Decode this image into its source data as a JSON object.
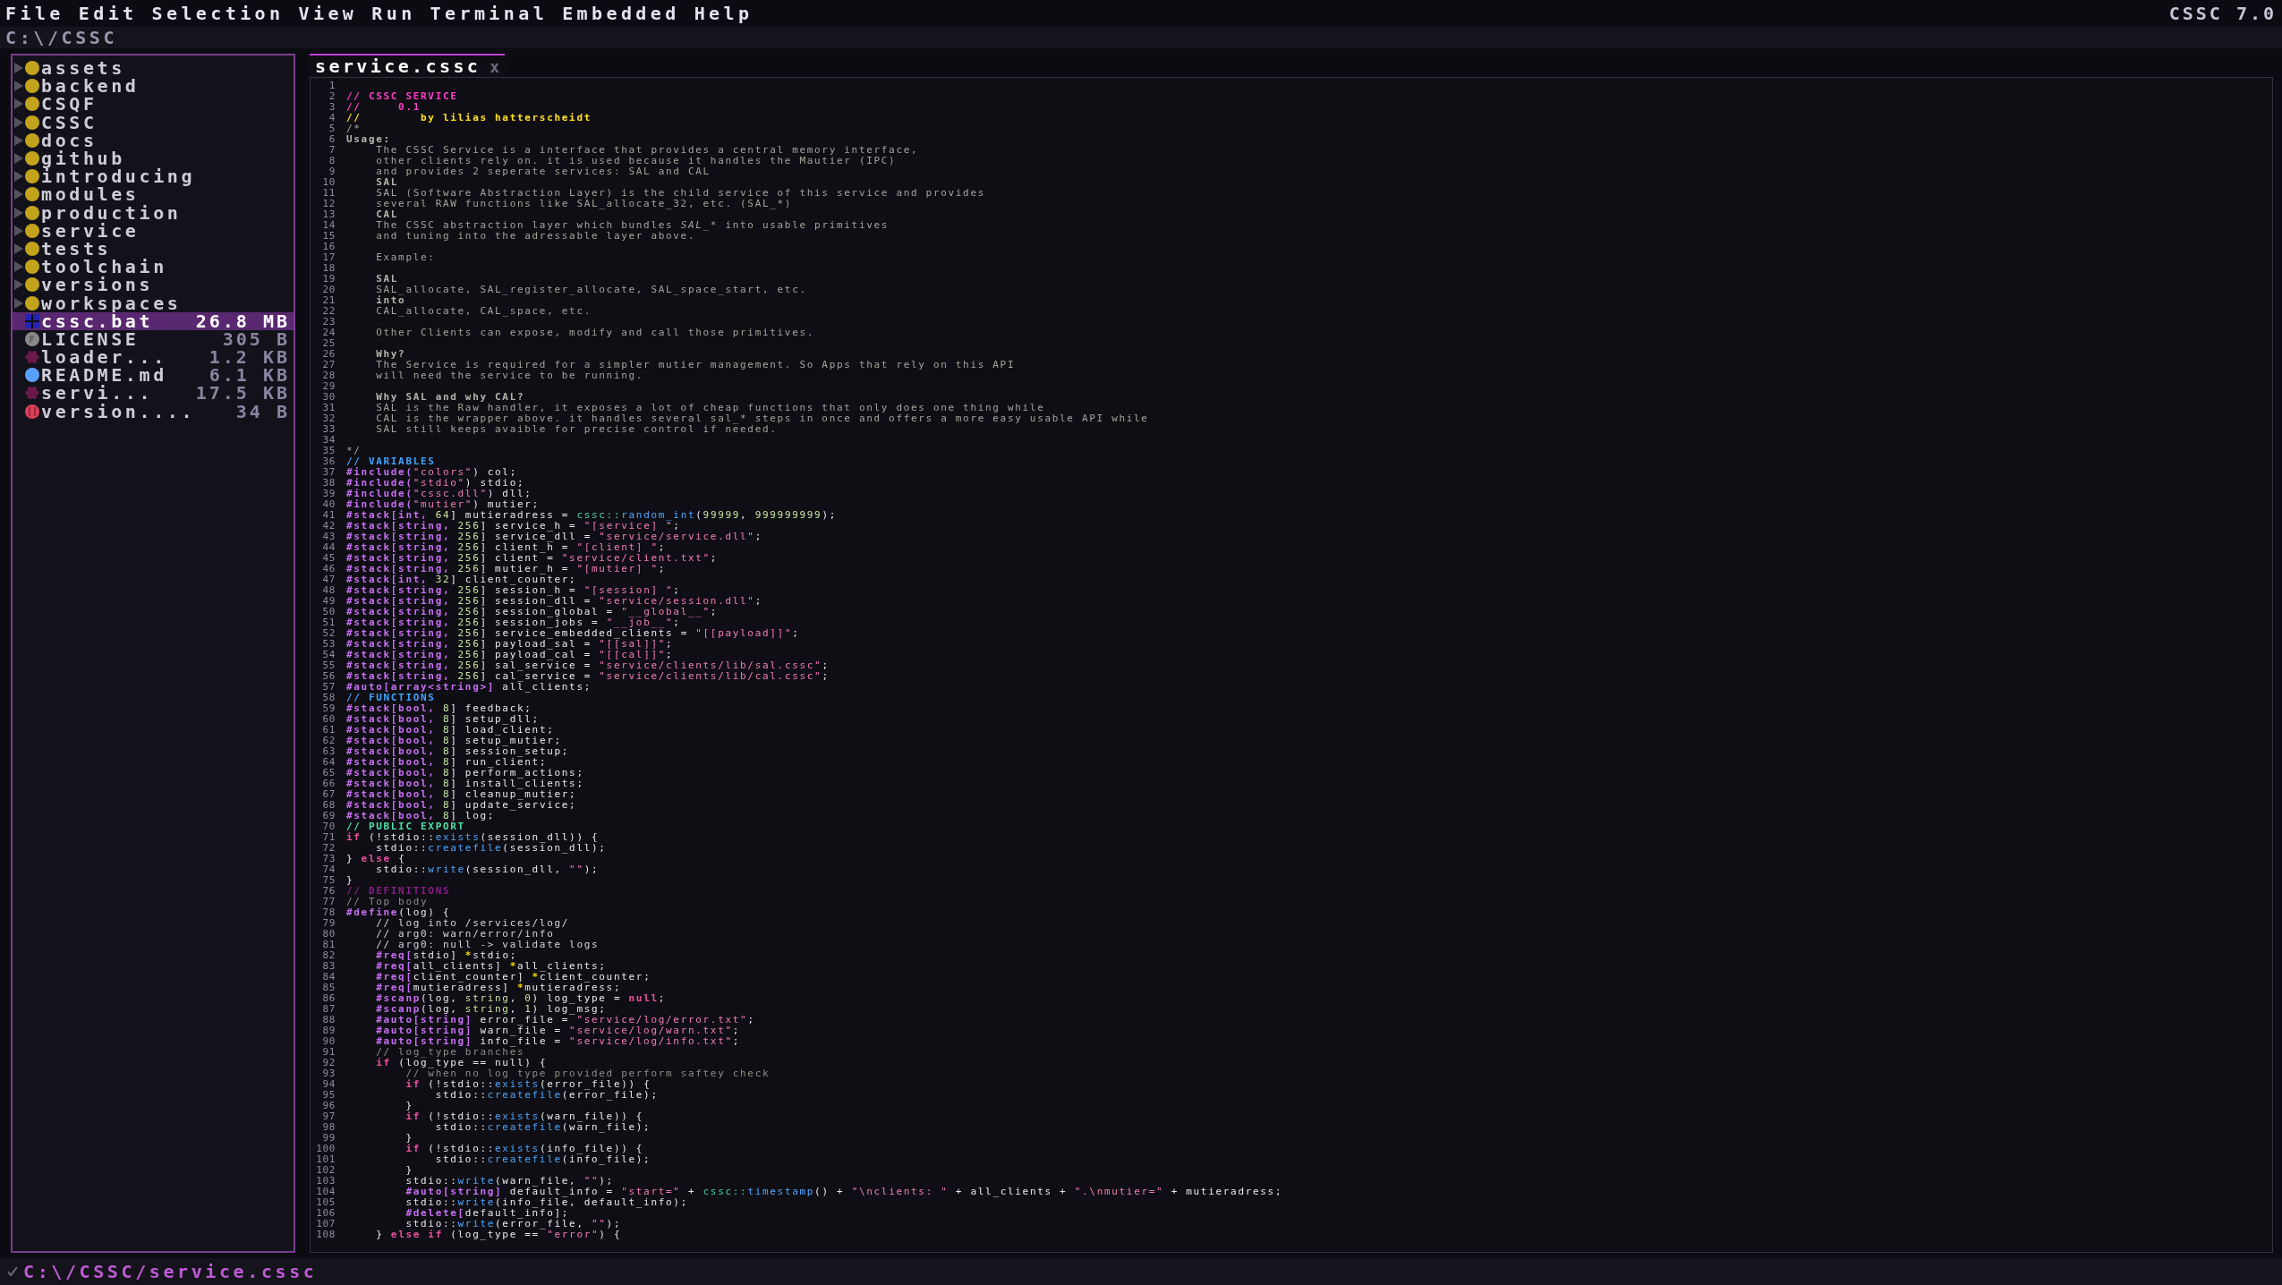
{
  "menu_bar": {
    "items": [
      "File",
      "Edit",
      "Selection",
      "View",
      "Run",
      "Terminal",
      "Embedded",
      "Help"
    ],
    "version": "CSSC 7.0"
  },
  "path_bar": {
    "path": "C:\\/CSSC"
  },
  "sidebar": {
    "items": [
      {
        "name": "assets",
        "kind": "folder",
        "selected": false
      },
      {
        "name": "backend",
        "kind": "folder",
        "selected": false
      },
      {
        "name": "CSQF",
        "kind": "folder",
        "selected": false
      },
      {
        "name": "CSSC",
        "kind": "folder",
        "selected": false
      },
      {
        "name": "docs",
        "kind": "folder",
        "selected": false
      },
      {
        "name": "github",
        "kind": "folder",
        "selected": false
      },
      {
        "name": "introducing",
        "kind": "folder",
        "selected": false
      },
      {
        "name": "modules",
        "kind": "folder",
        "selected": false
      },
      {
        "name": "production",
        "kind": "folder",
        "selected": false
      },
      {
        "name": "service",
        "kind": "folder",
        "selected": false
      },
      {
        "name": "tests",
        "kind": "folder",
        "selected": false
      },
      {
        "name": "toolchain",
        "kind": "folder",
        "selected": false
      },
      {
        "name": "versions",
        "kind": "folder",
        "selected": false
      },
      {
        "name": "workspaces",
        "kind": "folder",
        "selected": false
      },
      {
        "name": "cssc.bat",
        "kind": "batch",
        "size": "26.8 MB",
        "selected": true
      },
      {
        "name": "LICENSE",
        "kind": "license",
        "size": "305 B",
        "selected": false
      },
      {
        "name": "loader...",
        "kind": "cssc",
        "size": "1.2 KB",
        "selected": false
      },
      {
        "name": "README.md",
        "kind": "markdown",
        "size": "6.1 KB",
        "selected": false
      },
      {
        "name": "servi...",
        "kind": "cssc",
        "size": "17.5 KB",
        "selected": false
      },
      {
        "name": "version....",
        "kind": "version",
        "size": "34 B",
        "selected": false
      }
    ]
  },
  "tabs": [
    {
      "label": "service.cssc",
      "close": "x",
      "selected": true
    }
  ],
  "editor": {
    "lines": [
      {
        "number": "1"
      },
      {
        "number": "2",
        "tokens": [
          {
            "kind": "cp",
            "text": "// CSSC SERVICE"
          }
        ]
      },
      {
        "number": "3",
        "tokens": [
          {
            "kind": "cp",
            "text": "//     0.1"
          }
        ]
      },
      {
        "number": "4",
        "tokens": [
          {
            "kind": "cy",
            "text": "//        by lilias hatterscheidt"
          }
        ]
      },
      {
        "number": "5",
        "tokens": [
          {
            "kind": "doc",
            "text": "/*"
          }
        ]
      },
      {
        "number": "6",
        "tokens": [
          {
            "kind": "h",
            "text": "Usage:"
          }
        ]
      },
      {
        "number": "7",
        "tokens": [
          {
            "kind": "doc",
            "text": "    The CSSC Service is a interface that provides a central memory interface,"
          }
        ]
      },
      {
        "number": "8",
        "tokens": [
          {
            "kind": "doc",
            "text": "    other clients rely on. it is used because it handles the Mautier (IPC)"
          }
        ]
      },
      {
        "number": "9",
        "tokens": [
          {
            "kind": "doc",
            "text": "    and provides 2 seperate services: SAL and CAL"
          }
        ]
      },
      {
        "number": "10",
        "tokens": [
          {
            "kind": "h",
            "text": "    SAL"
          }
        ]
      },
      {
        "number": "11",
        "tokens": [
          {
            "kind": "doc",
            "text": "    SAL (Software Abstraction Layer) is the child service of this service and provides"
          }
        ]
      },
      {
        "number": "12",
        "tokens": [
          {
            "kind": "doc",
            "text": "    several RAW functions like SAL_allocate_32, etc. (SAL_*)"
          }
        ]
      },
      {
        "number": "13",
        "tokens": [
          {
            "kind": "h",
            "text": "    CAL"
          }
        ]
      },
      {
        "number": "14",
        "tokens": [
          {
            "kind": "doc",
            "text": "    The CSSC abstraction layer which bundles "
          },
          {
            "kind": "doci",
            "text": "SAL_*"
          },
          {
            "kind": "doc",
            "text": " into usable primitives"
          }
        ]
      },
      {
        "number": "15",
        "tokens": [
          {
            "kind": "doc",
            "text": "    and tuning into the adressable layer above."
          }
        ]
      },
      {
        "number": "16"
      },
      {
        "number": "17",
        "tokens": [
          {
            "kind": "doc",
            "text": "    Example:"
          }
        ]
      },
      {
        "number": "18"
      },
      {
        "number": "19",
        "tokens": [
          {
            "kind": "h",
            "text": "    SAL"
          }
        ]
      },
      {
        "number": "20",
        "tokens": [
          {
            "kind": "doc",
            "text": "    SAL_allocate, SAL_register_allocate, SAL_space_start, etc."
          }
        ]
      },
      {
        "number": "21",
        "tokens": [
          {
            "kind": "h",
            "text": "    into"
          }
        ]
      },
      {
        "number": "22",
        "tokens": [
          {
            "kind": "doc",
            "text": "    CAL_allocate, CAL_space, etc."
          }
        ]
      },
      {
        "number": "23"
      },
      {
        "number": "24",
        "tokens": [
          {
            "kind": "doc",
            "text": "    Other Clients can expose, modify and call those primitives."
          }
        ]
      },
      {
        "number": "25"
      },
      {
        "number": "26",
        "tokens": [
          {
            "kind": "h",
            "text": "    Why?"
          }
        ]
      },
      {
        "number": "27",
        "tokens": [
          {
            "kind": "doc",
            "text": "    The Service is required for a simpler mutier management. So Apps that rely on this API"
          }
        ]
      },
      {
        "number": "28",
        "tokens": [
          {
            "kind": "doc",
            "text": "    will need the service to be running."
          }
        ]
      },
      {
        "number": "29"
      },
      {
        "number": "30",
        "tokens": [
          {
            "kind": "h",
            "text": "    Why SAL and why CAL?"
          }
        ]
      },
      {
        "number": "31",
        "tokens": [
          {
            "kind": "doc",
            "text": "    SAL is the Raw handler, it exposes a lot of cheap functions that only does one thing while"
          }
        ]
      },
      {
        "number": "32",
        "tokens": [
          {
            "kind": "doc",
            "text": "    CAL is the wrapper above. it handles several sal_* steps in once and offers a more easy usable API while"
          }
        ]
      },
      {
        "number": "33",
        "tokens": [
          {
            "kind": "doc",
            "text": "    SAL still keeps avaible for precise control if needed."
          }
        ]
      },
      {
        "number": "34"
      },
      {
        "number": "35",
        "tokens": [
          {
            "kind": "doc",
            "text": "*/"
          }
        ]
      },
      {
        "number": "36",
        "tokens": [
          {
            "kind": "cb",
            "text": "// VARIABLES"
          }
        ]
      },
      {
        "number": "37",
        "tokens": [
          {
            "kind": "pre",
            "text": "#include("
          },
          {
            "kind": "str",
            "text": "\"colors\""
          },
          {
            "kind": "p",
            "text": ") col;"
          }
        ]
      },
      {
        "number": "38",
        "tokens": [
          {
            "kind": "pre",
            "text": "#include("
          },
          {
            "kind": "str",
            "text": "\"stdio\""
          },
          {
            "kind": "p",
            "text": ") stdio;"
          }
        ]
      },
      {
        "number": "39",
        "tokens": [
          {
            "kind": "pre",
            "text": "#include("
          },
          {
            "kind": "str",
            "text": "\"cssc.dll\""
          },
          {
            "kind": "p",
            "text": ") dll;"
          }
        ]
      },
      {
        "number": "40",
        "tokens": [
          {
            "kind": "pre",
            "text": "#include("
          },
          {
            "kind": "str",
            "text": "\"mutier\""
          },
          {
            "kind": "p",
            "text": ") mutier;"
          }
        ]
      },
      {
        "number": "41",
        "tokens": [
          {
            "kind": "pre",
            "text": "#stack[int, "
          },
          {
            "kind": "num",
            "text": "64"
          },
          {
            "kind": "p",
            "text": "] mutieradress = "
          },
          {
            "kind": "ns",
            "text": "cssc::"
          },
          {
            "kind": "fn",
            "text": "random_int"
          },
          {
            "kind": "p",
            "text": "("
          },
          {
            "kind": "num",
            "text": "99999"
          },
          {
            "kind": "p",
            "text": ", "
          },
          {
            "kind": "num",
            "text": "999999999"
          },
          {
            "kind": "p",
            "text": ");"
          }
        ]
      },
      {
        "number": "42",
        "tokens": [
          {
            "kind": "pre",
            "text": "#stack[string, "
          },
          {
            "kind": "num",
            "text": "256"
          },
          {
            "kind": "p",
            "text": "] service_h = "
          },
          {
            "kind": "str",
            "text": "\"[service] \""
          },
          {
            "kind": "p",
            "text": ";"
          }
        ]
      },
      {
        "number": "43",
        "tokens": [
          {
            "kind": "pre",
            "text": "#stack[string, "
          },
          {
            "kind": "num",
            "text": "256"
          },
          {
            "kind": "p",
            "text": "] service_dll = "
          },
          {
            "kind": "str",
            "text": "\"service/service.dll\""
          },
          {
            "kind": "p",
            "text": ";"
          }
        ]
      },
      {
        "number": "44",
        "tokens": [
          {
            "kind": "pre",
            "text": "#stack[string, "
          },
          {
            "kind": "num",
            "text": "256"
          },
          {
            "kind": "p",
            "text": "] client_h = "
          },
          {
            "kind": "str",
            "text": "\"[client] \""
          },
          {
            "kind": "p",
            "text": ";"
          }
        ]
      },
      {
        "number": "45",
        "tokens": [
          {
            "kind": "pre",
            "text": "#stack[string, "
          },
          {
            "kind": "num",
            "text": "256"
          },
          {
            "kind": "p",
            "text": "] client = "
          },
          {
            "kind": "str",
            "text": "\"service/client.txt\""
          },
          {
            "kind": "p",
            "text": ";"
          }
        ]
      },
      {
        "number": "46",
        "tokens": [
          {
            "kind": "pre",
            "text": "#stack[string, "
          },
          {
            "kind": "num",
            "text": "256"
          },
          {
            "kind": "p",
            "text": "] mutier_h = "
          },
          {
            "kind": "str",
            "text": "\"[mutier] \""
          },
          {
            "kind": "p",
            "text": ";"
          }
        ]
      },
      {
        "number": "47",
        "tokens": [
          {
            "kind": "pre",
            "text": "#stack[int, "
          },
          {
            "kind": "num",
            "text": "32"
          },
          {
            "kind": "p",
            "text": "] client_counter;"
          }
        ]
      },
      {
        "number": "48",
        "tokens": [
          {
            "kind": "pre",
            "text": "#stack[string, "
          },
          {
            "kind": "num",
            "text": "256"
          },
          {
            "kind": "p",
            "text": "] session_h = "
          },
          {
            "kind": "str",
            "text": "\"[session] \""
          },
          {
            "kind": "p",
            "text": ";"
          }
        ]
      },
      {
        "number": "49",
        "tokens": [
          {
            "kind": "pre",
            "text": "#stack[string, "
          },
          {
            "kind": "num",
            "text": "256"
          },
          {
            "kind": "p",
            "text": "] session_dll = "
          },
          {
            "kind": "str",
            "text": "\"service/session.dll\""
          },
          {
            "kind": "p",
            "text": ";"
          }
        ]
      },
      {
        "number": "50",
        "tokens": [
          {
            "kind": "pre",
            "text": "#stack[string, "
          },
          {
            "kind": "num",
            "text": "256"
          },
          {
            "kind": "p",
            "text": "] session_global = "
          },
          {
            "kind": "str",
            "text": "\"__global__\""
          },
          {
            "kind": "p",
            "text": ";"
          }
        ]
      },
      {
        "number": "51",
        "tokens": [
          {
            "kind": "pre",
            "text": "#stack[string, "
          },
          {
            "kind": "num",
            "text": "256"
          },
          {
            "kind": "p",
            "text": "] session_jobs = "
          },
          {
            "kind": "str",
            "text": "\"__job__\""
          },
          {
            "kind": "p",
            "text": ";"
          }
        ]
      },
      {
        "number": "52",
        "tokens": [
          {
            "kind": "pre",
            "text": "#stack[string, "
          },
          {
            "kind": "num",
            "text": "256"
          },
          {
            "kind": "p",
            "text": "] service_embedded_clients = "
          },
          {
            "kind": "str",
            "text": "\"[[payload]]\""
          },
          {
            "kind": "p",
            "text": ";"
          }
        ]
      },
      {
        "number": "53",
        "tokens": [
          {
            "kind": "pre",
            "text": "#stack[string, "
          },
          {
            "kind": "num",
            "text": "256"
          },
          {
            "kind": "p",
            "text": "] payload_sal = "
          },
          {
            "kind": "str",
            "text": "\"[[sal]]\""
          },
          {
            "kind": "p",
            "text": ";"
          }
        ]
      },
      {
        "number": "54",
        "tokens": [
          {
            "kind": "pre",
            "text": "#stack[string, "
          },
          {
            "kind": "num",
            "text": "256"
          },
          {
            "kind": "p",
            "text": "] payload_cal = "
          },
          {
            "kind": "str",
            "text": "\"[[cal]]\""
          },
          {
            "kind": "p",
            "text": ";"
          }
        ]
      },
      {
        "number": "55",
        "tokens": [
          {
            "kind": "pre",
            "text": "#stack[string, "
          },
          {
            "kind": "num",
            "text": "256"
          },
          {
            "kind": "p",
            "text": "] sal_service = "
          },
          {
            "kind": "str",
            "text": "\"service/clients/lib/sal.cssc\""
          },
          {
            "kind": "p",
            "text": ";"
          }
        ]
      },
      {
        "number": "56",
        "tokens": [
          {
            "kind": "pre",
            "text": "#stack[string, "
          },
          {
            "kind": "num",
            "text": "256"
          },
          {
            "kind": "p",
            "text": "] cal_service = "
          },
          {
            "kind": "str",
            "text": "\"service/clients/lib/cal.cssc\""
          },
          {
            "kind": "p",
            "text": ";"
          }
        ]
      },
      {
        "number": "57",
        "tokens": [
          {
            "kind": "pre",
            "text": "#auto[array<string>]"
          },
          {
            "kind": "p",
            "text": " all_clients;"
          }
        ]
      },
      {
        "number": "58",
        "tokens": [
          {
            "kind": "cb",
            "text": "// FUNCTIONS"
          }
        ]
      },
      {
        "number": "59",
        "tokens": [
          {
            "kind": "pre",
            "text": "#stack[bool, "
          },
          {
            "kind": "num",
            "text": "8"
          },
          {
            "kind": "p",
            "text": "] feedback;"
          }
        ]
      },
      {
        "number": "60",
        "tokens": [
          {
            "kind": "pre",
            "text": "#stack[bool, "
          },
          {
            "kind": "num",
            "text": "8"
          },
          {
            "kind": "p",
            "text": "] setup_dll;"
          }
        ]
      },
      {
        "number": "61",
        "tokens": [
          {
            "kind": "pre",
            "text": "#stack[bool, "
          },
          {
            "kind": "num",
            "text": "8"
          },
          {
            "kind": "p",
            "text": "] load_client;"
          }
        ]
      },
      {
        "number": "62",
        "tokens": [
          {
            "kind": "pre",
            "text": "#stack[bool, "
          },
          {
            "kind": "num",
            "text": "8"
          },
          {
            "kind": "p",
            "text": "] setup_mutier;"
          }
        ]
      },
      {
        "number": "63",
        "tokens": [
          {
            "kind": "pre",
            "text": "#stack[bool, "
          },
          {
            "kind": "num",
            "text": "8"
          },
          {
            "kind": "p",
            "text": "] session_setup;"
          }
        ]
      },
      {
        "number": "64",
        "tokens": [
          {
            "kind": "pre",
            "text": "#stack[bool, "
          },
          {
            "kind": "num",
            "text": "8"
          },
          {
            "kind": "p",
            "text": "] run_client;"
          }
        ]
      },
      {
        "number": "65",
        "tokens": [
          {
            "kind": "pre",
            "text": "#stack[bool, "
          },
          {
            "kind": "num",
            "text": "8"
          },
          {
            "kind": "p",
            "text": "] perform_actions;"
          }
        ]
      },
      {
        "number": "66",
        "tokens": [
          {
            "kind": "pre",
            "text": "#stack[bool, "
          },
          {
            "kind": "num",
            "text": "8"
          },
          {
            "kind": "p",
            "text": "] install_clients;"
          }
        ]
      },
      {
        "number": "67",
        "tokens": [
          {
            "kind": "pre",
            "text": "#stack[bool, "
          },
          {
            "kind": "num",
            "text": "8"
          },
          {
            "kind": "p",
            "text": "] cleanup_mutier;"
          }
        ]
      },
      {
        "number": "68",
        "tokens": [
          {
            "kind": "pre",
            "text": "#stack[bool, "
          },
          {
            "kind": "num",
            "text": "8"
          },
          {
            "kind": "p",
            "text": "] update_service;"
          }
        ]
      },
      {
        "number": "69",
        "tokens": [
          {
            "kind": "pre",
            "text": "#stack[bool, "
          },
          {
            "kind": "num",
            "text": "8"
          },
          {
            "kind": "p",
            "text": "] log;"
          }
        ]
      },
      {
        "number": "70",
        "tokens": [
          {
            "kind": "cg",
            "text": "// PUBLIC EXPORT"
          }
        ]
      },
      {
        "number": "71",
        "tokens": [
          {
            "kind": "kw",
            "text": "if"
          },
          {
            "kind": "p",
            "text": " (!stdio::"
          },
          {
            "kind": "fn",
            "text": "exists"
          },
          {
            "kind": "p",
            "text": "(session_dll)) {"
          }
        ]
      },
      {
        "number": "72",
        "tokens": [
          {
            "kind": "p",
            "text": "    stdio::"
          },
          {
            "kind": "fn",
            "text": "createfile"
          },
          {
            "kind": "p",
            "text": "(session_dll);"
          }
        ]
      },
      {
        "number": "73",
        "tokens": [
          {
            "kind": "p",
            "text": "} "
          },
          {
            "kind": "kw",
            "text": "else"
          },
          {
            "kind": "p",
            "text": " {"
          }
        ]
      },
      {
        "number": "74",
        "tokens": [
          {
            "kind": "p",
            "text": "    stdio::"
          },
          {
            "kind": "fn",
            "text": "write"
          },
          {
            "kind": "p",
            "text": "(session_dll, "
          },
          {
            "kind": "str",
            "text": "\"\""
          },
          {
            "kind": "p",
            "text": ");"
          }
        ]
      },
      {
        "number": "75",
        "tokens": [
          {
            "kind": "p",
            "text": "}"
          }
        ]
      },
      {
        "number": "76",
        "tokens": [
          {
            "kind": "cd",
            "text": "// DEFINITIONS"
          }
        ]
      },
      {
        "number": "77",
        "tokens": [
          {
            "kind": "c",
            "text": "// Top body"
          }
        ]
      },
      {
        "number": "78",
        "tokens": [
          {
            "kind": "pre",
            "text": "#define"
          },
          {
            "kind": "p",
            "text": "(log) {"
          }
        ]
      },
      {
        "number": "79",
        "tokens": [
          {
            "kind": "cw",
            "text": "    // log into /services/log/"
          }
        ]
      },
      {
        "number": "80",
        "tokens": [
          {
            "kind": "cw",
            "text": "    // arg0: warn/error/info"
          }
        ]
      },
      {
        "number": "81",
        "tokens": [
          {
            "kind": "cw",
            "text": "    // arg0: null -> validate logs"
          }
        ]
      },
      {
        "number": "82",
        "tokens": [
          {
            "kind": "pre",
            "text": "    #req["
          },
          {
            "kind": "p",
            "text": "stdio] "
          },
          {
            "kind": "star",
            "text": "*"
          },
          {
            "kind": "p",
            "text": "stdio;"
          }
        ]
      },
      {
        "number": "83",
        "tokens": [
          {
            "kind": "pre",
            "text": "    #req["
          },
          {
            "kind": "p",
            "text": "all_clients] "
          },
          {
            "kind": "star",
            "text": "*"
          },
          {
            "kind": "p",
            "text": "all_clients;"
          }
        ]
      },
      {
        "number": "84",
        "tokens": [
          {
            "kind": "pre",
            "text": "    #req["
          },
          {
            "kind": "p",
            "text": "client_counter] "
          },
          {
            "kind": "star",
            "text": "*"
          },
          {
            "kind": "p",
            "text": "client_counter;"
          }
        ]
      },
      {
        "number": "85",
        "tokens": [
          {
            "kind": "pre",
            "text": "    #req["
          },
          {
            "kind": "p",
            "text": "mutieradress] "
          },
          {
            "kind": "star",
            "text": "*"
          },
          {
            "kind": "p",
            "text": "mutieradress;"
          }
        ]
      },
      {
        "number": "86",
        "tokens": [
          {
            "kind": "pre",
            "text": "    #scanp"
          },
          {
            "kind": "p",
            "text": "(log, "
          },
          {
            "kind": "num",
            "text": "string"
          },
          {
            "kind": "p",
            "text": ", "
          },
          {
            "kind": "num",
            "text": "0"
          },
          {
            "kind": "p",
            "text": ") log_type = "
          },
          {
            "kind": "kw",
            "text": "null"
          },
          {
            "kind": "p",
            "text": ";"
          }
        ]
      },
      {
        "number": "87",
        "tokens": [
          {
            "kind": "pre",
            "text": "    #scanp"
          },
          {
            "kind": "p",
            "text": "(log, "
          },
          {
            "kind": "num",
            "text": "string"
          },
          {
            "kind": "p",
            "text": ", "
          },
          {
            "kind": "num",
            "text": "1"
          },
          {
            "kind": "p",
            "text": ") log_msg;"
          }
        ]
      },
      {
        "number": "88",
        "tokens": [
          {
            "kind": "pre",
            "text": "    #auto[string]"
          },
          {
            "kind": "p",
            "text": " error_file = "
          },
          {
            "kind": "str",
            "text": "\"service/log/error.txt\""
          },
          {
            "kind": "p",
            "text": ";"
          }
        ]
      },
      {
        "number": "89",
        "tokens": [
          {
            "kind": "pre",
            "text": "    #auto[string]"
          },
          {
            "kind": "p",
            "text": " warn_file = "
          },
          {
            "kind": "str",
            "text": "\"service/log/warn.txt\""
          },
          {
            "kind": "p",
            "text": ";"
          }
        ]
      },
      {
        "number": "90",
        "tokens": [
          {
            "kind": "pre",
            "text": "    #auto[string]"
          },
          {
            "kind": "p",
            "text": " info_file = "
          },
          {
            "kind": "str",
            "text": "\"service/log/info.txt\""
          },
          {
            "kind": "p",
            "text": ";"
          }
        ]
      },
      {
        "number": "91",
        "tokens": [
          {
            "kind": "c",
            "text": "    // log_type branches"
          }
        ]
      },
      {
        "number": "92",
        "tokens": [
          {
            "kind": "kw",
            "text": "    if"
          },
          {
            "kind": "p",
            "text": " (log_type == null) {"
          }
        ]
      },
      {
        "number": "93",
        "tokens": [
          {
            "kind": "c",
            "text": "        // when no log type provided perform saftey check"
          }
        ]
      },
      {
        "number": "94",
        "tokens": [
          {
            "kind": "kw",
            "text": "        if"
          },
          {
            "kind": "p",
            "text": " (!stdio::"
          },
          {
            "kind": "fn",
            "text": "exists"
          },
          {
            "kind": "p",
            "text": "(error_file)) {"
          }
        ]
      },
      {
        "number": "95",
        "tokens": [
          {
            "kind": "p",
            "text": "            stdio::"
          },
          {
            "kind": "fn",
            "text": "createfile"
          },
          {
            "kind": "p",
            "text": "(error_file);"
          }
        ]
      },
      {
        "number": "96",
        "tokens": [
          {
            "kind": "p",
            "text": "        }"
          }
        ]
      },
      {
        "number": "97",
        "tokens": [
          {
            "kind": "kw",
            "text": "        if"
          },
          {
            "kind": "p",
            "text": " (!stdio::"
          },
          {
            "kind": "fn",
            "text": "exists"
          },
          {
            "kind": "p",
            "text": "(warn_file)) {"
          }
        ]
      },
      {
        "number": "98",
        "tokens": [
          {
            "kind": "p",
            "text": "            stdio::"
          },
          {
            "kind": "fn",
            "text": "createfile"
          },
          {
            "kind": "p",
            "text": "(warn_file);"
          }
        ]
      },
      {
        "number": "99",
        "tokens": [
          {
            "kind": "p",
            "text": "        }"
          }
        ]
      },
      {
        "number": "100",
        "tokens": [
          {
            "kind": "kw",
            "text": "        if"
          },
          {
            "kind": "p",
            "text": " (!stdio::"
          },
          {
            "kind": "fn",
            "text": "exists"
          },
          {
            "kind": "p",
            "text": "(info_file)) {"
          }
        ]
      },
      {
        "number": "101",
        "tokens": [
          {
            "kind": "p",
            "text": "            stdio::"
          },
          {
            "kind": "fn",
            "text": "createfile"
          },
          {
            "kind": "p",
            "text": "(info_file);"
          }
        ]
      },
      {
        "number": "102",
        "tokens": [
          {
            "kind": "p",
            "text": "        }"
          }
        ]
      },
      {
        "number": "103",
        "tokens": [
          {
            "kind": "p",
            "text": "        stdio::"
          },
          {
            "kind": "fn",
            "text": "write"
          },
          {
            "kind": "p",
            "text": "(warn_file, "
          },
          {
            "kind": "str",
            "text": "\"\""
          },
          {
            "kind": "p",
            "text": ");"
          }
        ]
      },
      {
        "number": "104",
        "tokens": [
          {
            "kind": "pre",
            "text": "        #auto[string]"
          },
          {
            "kind": "p",
            "text": " default_info = "
          },
          {
            "kind": "str",
            "text": "\"start=\""
          },
          {
            "kind": "p",
            "text": " + "
          },
          {
            "kind": "ns",
            "text": "cssc::"
          },
          {
            "kind": "fn",
            "text": "timestamp"
          },
          {
            "kind": "p",
            "text": "() + "
          },
          {
            "kind": "str",
            "text": "\"\\nclients: \""
          },
          {
            "kind": "p",
            "text": " + all_clients + "
          },
          {
            "kind": "str",
            "text": "\".\\nmutier=\""
          },
          {
            "kind": "p",
            "text": " + mutieradress;"
          }
        ]
      },
      {
        "number": "105",
        "tokens": [
          {
            "kind": "p",
            "text": "        stdio::"
          },
          {
            "kind": "fn",
            "text": "write"
          },
          {
            "kind": "p",
            "text": "(info_file, default_info);"
          }
        ]
      },
      {
        "number": "106",
        "tokens": [
          {
            "kind": "pre",
            "text": "        #delete["
          },
          {
            "kind": "p",
            "text": "default_info];"
          }
        ]
      },
      {
        "number": "107",
        "tokens": [
          {
            "kind": "p",
            "text": "        stdio::"
          },
          {
            "kind": "fn",
            "text": "write"
          },
          {
            "kind": "p",
            "text": "(error_file, "
          },
          {
            "kind": "str",
            "text": "\"\""
          },
          {
            "kind": "p",
            "text": ");"
          }
        ]
      },
      {
        "number": "108",
        "tokens": [
          {
            "kind": "p",
            "text": "    } "
          },
          {
            "kind": "kw",
            "text": "else if"
          },
          {
            "kind": "p",
            "text": " (log_type == "
          },
          {
            "kind": "str",
            "text": "\"error\""
          },
          {
            "kind": "p",
            "text": ") {"
          }
        ]
      }
    ]
  },
  "status_bar": {
    "path": "C:\\/CSSC/service.cssc"
  }
}
